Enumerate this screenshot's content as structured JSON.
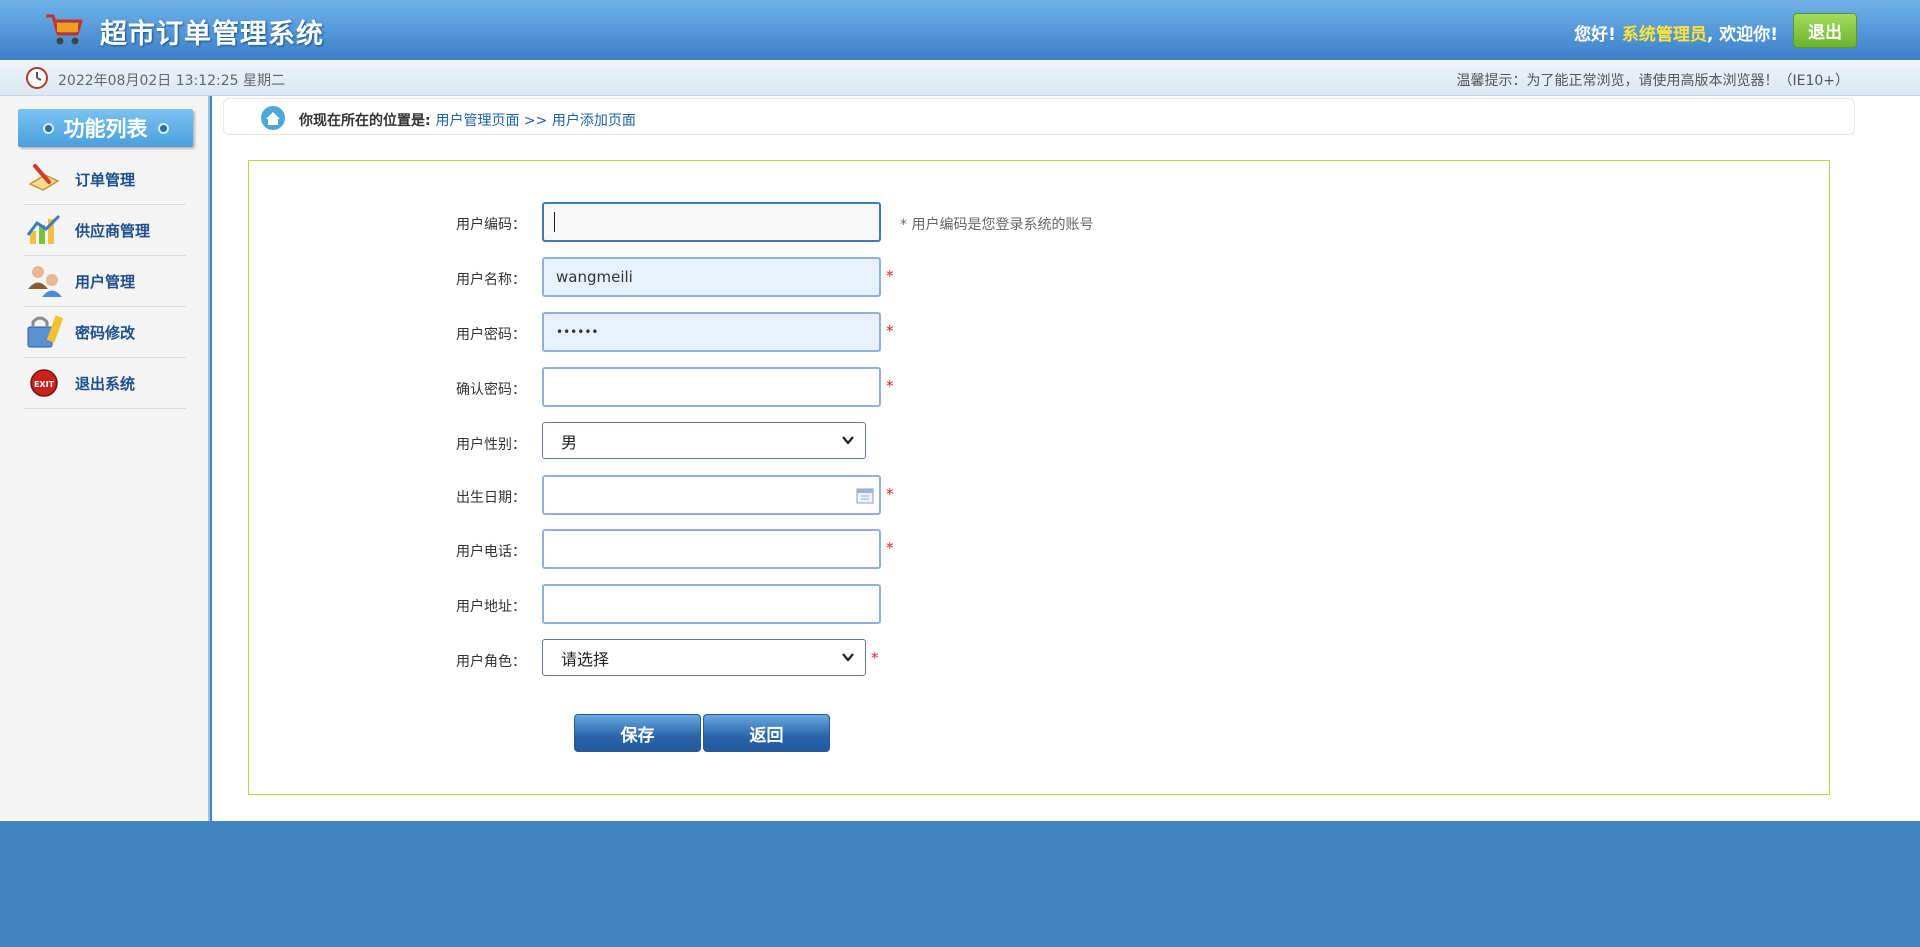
{
  "header": {
    "title": "超市订单管理系统",
    "greeting": "您好!",
    "username": "系统管理员",
    "welcome": ", 欢迎你!",
    "logout_label": "退出",
    "icon": "shopping-cart-icon"
  },
  "subbar": {
    "datetime": "2022年08月02日 13:12:25 星期二",
    "tip": "温馨提示：为了能正常浏览，请使用高版本浏览器！（IE10+）"
  },
  "sidebar": {
    "title": "功能列表",
    "items": [
      {
        "label": "订单管理",
        "icon": "order-icon"
      },
      {
        "label": "供应商管理",
        "icon": "supplier-chart-icon"
      },
      {
        "label": "用户管理",
        "icon": "users-icon"
      },
      {
        "label": "密码修改",
        "icon": "password-lock-icon"
      },
      {
        "label": "退出系统",
        "icon": "exit-icon"
      }
    ]
  },
  "breadcrumb": {
    "prefix": "你现在所在的位置是:",
    "path": "用户管理页面 >> 用户添加页面"
  },
  "form": {
    "user_code_label": "用户编码：",
    "user_code_value": "",
    "user_code_hint": "* 用户编码是您登录系统的账号",
    "user_name_label": "用户名称：",
    "user_name_value": "wangmeili",
    "password_label": "用户密码：",
    "password_value": "••••••",
    "confirm_label": "确认密码：",
    "confirm_value": "",
    "gender_label": "用户性别：",
    "gender_value": "男",
    "birthday_label": "出生日期：",
    "birthday_value": "",
    "phone_label": "用户电话：",
    "phone_value": "",
    "address_label": "用户地址：",
    "address_value": "",
    "role_label": "用户角色：",
    "role_value": "请选择",
    "required_mark": "*",
    "save_label": "保存",
    "back_label": "返回"
  },
  "colors": {
    "header_blue": "#3b80c8",
    "accent_green": "#6cb32b",
    "admin_yellow": "#ffe33b",
    "form_border": "#c1d04a",
    "required_red": "#e02020"
  }
}
